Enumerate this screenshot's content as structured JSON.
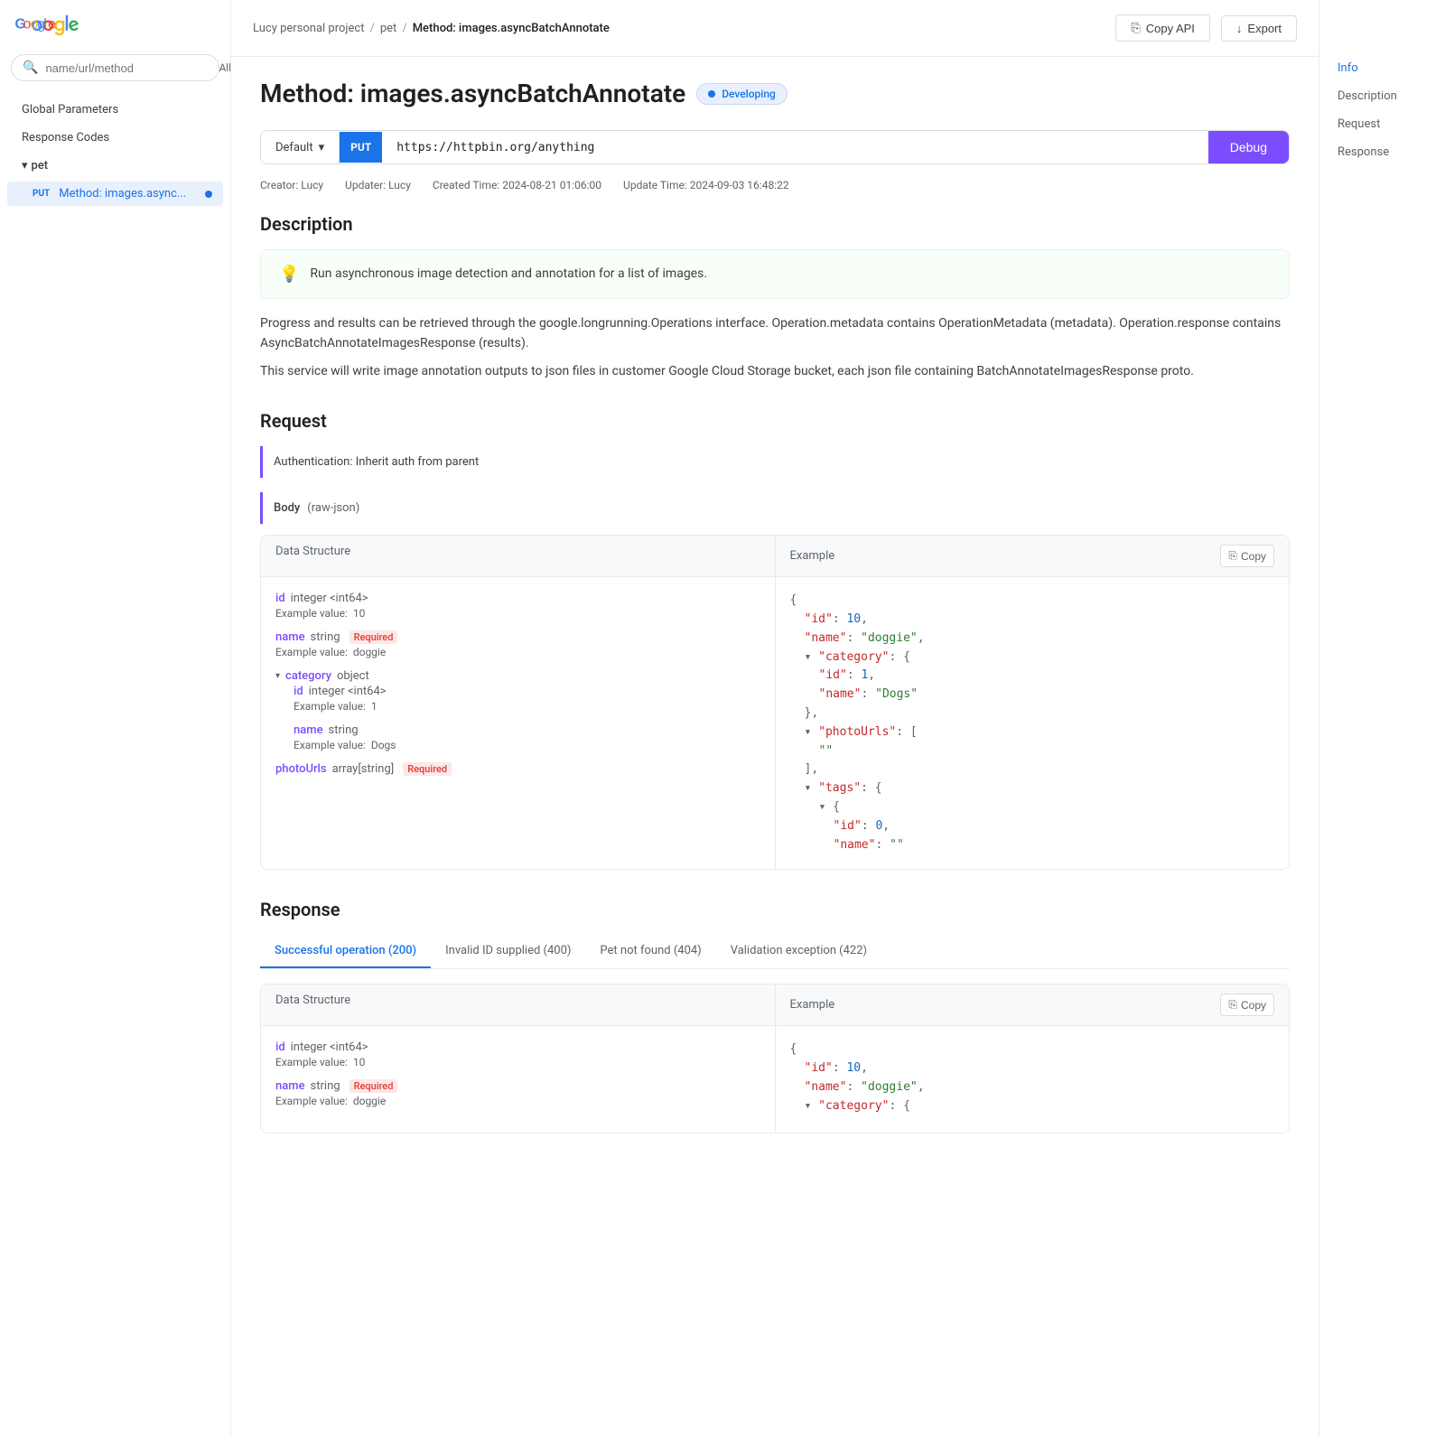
{
  "sidebar": {
    "search_placeholder": "name/url/method",
    "filter_label": "All",
    "nav_items": [
      {
        "label": "Global Parameters"
      },
      {
        "label": "Response Codes"
      }
    ],
    "section": "pet",
    "method_item": {
      "method": "PUT",
      "name": "Method: images.async...",
      "has_dot": true
    }
  },
  "breadcrumb": {
    "parts": [
      "Lucy personal project",
      "pet"
    ],
    "current": "Method: images.asyncBatchAnnotate"
  },
  "actions": {
    "copy_api": "Copy API",
    "export": "Export"
  },
  "page": {
    "title": "Method: images.asyncBatchAnnotate",
    "status": "Developing",
    "url_env": "Default",
    "method": "PUT",
    "url": "https://httpbin.org/anything",
    "debug_label": "Debug",
    "meta": {
      "creator": "Creator: Lucy",
      "updater": "Updater: Lucy",
      "created": "Created Time: 2024-08-21 01:06:00",
      "updated": "Update Time: 2024-09-03 16:48:22"
    }
  },
  "description": {
    "title": "Description",
    "highlight": "Run asynchronous image detection and annotation for a list of images.",
    "para1": "Progress and results can be retrieved through the google.longrunning.Operations interface. Operation.metadata contains OperationMetadata (metadata). Operation.response contains AsyncBatchAnnotateImagesResponse (results).",
    "para2": "This service will write image annotation outputs to json files in customer Google Cloud Storage bucket, each json file containing BatchAnnotateImagesResponse proto."
  },
  "request": {
    "title": "Request",
    "auth_label": "Authentication: Inherit auth from parent",
    "body_label": "Body",
    "body_tag": "(raw-json)",
    "data_structure_label": "Data Structure",
    "example_label": "Example",
    "copy_label": "Copy",
    "fields": [
      {
        "name": "id",
        "type": "integer <int64>",
        "example_label": "Example value:",
        "example_value": "10"
      },
      {
        "name": "name",
        "type": "string",
        "required": true,
        "example_label": "Example value:",
        "example_value": "doggie"
      },
      {
        "name": "category",
        "type": "object",
        "collapsible": true,
        "children": [
          {
            "name": "id",
            "type": "integer <int64>",
            "example_label": "Example value:",
            "example_value": "1"
          },
          {
            "name": "name",
            "type": "string",
            "example_label": "Example value:",
            "example_value": "Dogs"
          }
        ]
      },
      {
        "name": "photoUrls",
        "type": "array[string]",
        "required": true
      }
    ],
    "example_json": [
      {
        "indent": 0,
        "text": "{"
      },
      {
        "indent": 1,
        "key": "\"id\"",
        "value": " 10,",
        "value_type": "num"
      },
      {
        "indent": 1,
        "key": "\"name\"",
        "value": " \"doggie\",",
        "value_type": "str"
      },
      {
        "indent": 1,
        "key": "\"category\"",
        "value": " {",
        "value_type": "punct",
        "arrow": true
      },
      {
        "indent": 2,
        "key": "\"id\"",
        "value": " 1,",
        "value_type": "num"
      },
      {
        "indent": 2,
        "key": "\"name\"",
        "value": " \"Dogs\"",
        "value_type": "str"
      },
      {
        "indent": 1,
        "text": "},"
      },
      {
        "indent": 1,
        "key": "\"photoUrls\"",
        "value": " [",
        "value_type": "punct",
        "arrow": true
      },
      {
        "indent": 2,
        "value": "\"\"",
        "value_type": "str"
      },
      {
        "indent": 1,
        "text": "],"
      },
      {
        "indent": 1,
        "key": "\"tags\"",
        "value": " {",
        "value_type": "punct",
        "arrow": true
      },
      {
        "indent": 2,
        "arrow": true,
        "value": "{",
        "value_type": "punct"
      },
      {
        "indent": 3,
        "key": "\"id\"",
        "value": " 0,",
        "value_type": "num"
      },
      {
        "indent": 3,
        "key": "\"name\"",
        "value": " \"\"",
        "value_type": "str"
      }
    ]
  },
  "response": {
    "title": "Response",
    "tabs": [
      {
        "label": "Successful operation (200)",
        "active": true
      },
      {
        "label": "Invalid ID supplied (400)"
      },
      {
        "label": "Pet not found (404)"
      },
      {
        "label": "Validation exception (422)"
      }
    ],
    "data_structure_label": "Data Structure",
    "example_label": "Example",
    "copy_label": "Copy",
    "fields": [
      {
        "name": "id",
        "type": "integer <int64>",
        "example_label": "Example value:",
        "example_value": "10"
      },
      {
        "name": "name",
        "type": "string",
        "required": true,
        "example_label": "Example value:",
        "example_value": "doggie"
      }
    ],
    "example_json": [
      {
        "indent": 0,
        "text": "{"
      },
      {
        "indent": 1,
        "key": "\"id\"",
        "value": " 10,",
        "value_type": "num"
      },
      {
        "indent": 1,
        "key": "\"name\"",
        "value": " \"doggie\",",
        "value_type": "str"
      },
      {
        "indent": 1,
        "key": "\"category\"",
        "value": " {",
        "value_type": "punct",
        "arrow": true
      }
    ]
  },
  "right_nav": {
    "items": [
      "Info",
      "Description",
      "Request",
      "Response"
    ]
  }
}
